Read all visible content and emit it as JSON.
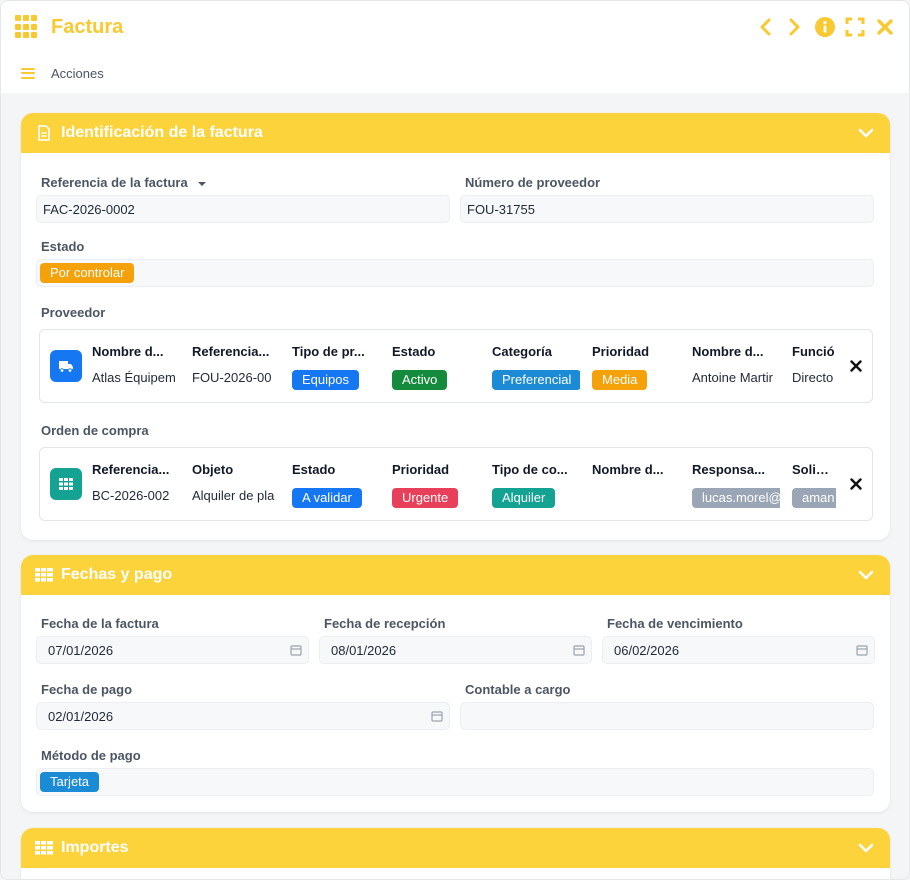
{
  "window": {
    "title": "Factura"
  },
  "menubar": {
    "actions_label": "Acciones"
  },
  "colors": {
    "accent": "#f9c932",
    "header": "#fdd33c"
  },
  "section1": {
    "title": "Identificación de la factura",
    "ref_label": "Referencia de la factura",
    "ref_value": "FAC-2026-0002",
    "supplier_number_label": "Número de proveedor",
    "supplier_number_value": "FOU-31755",
    "status_label": "Estado",
    "status_value": "Por controlar",
    "provider_label": "Proveedor",
    "provider_card": {
      "columns": [
        {
          "header": "Nombre d...",
          "value": "Atlas Équipem",
          "type": "text"
        },
        {
          "header": "Referencia...",
          "value": "FOU-2026-00",
          "type": "text"
        },
        {
          "header": "Tipo de pr...",
          "value": "Equipos",
          "type": "pill",
          "color": "#1677f2"
        },
        {
          "header": "Estado",
          "value": "Activo",
          "type": "pill",
          "color": "#148a3c"
        },
        {
          "header": "Categoría",
          "value": "Preferencial",
          "type": "pill",
          "color": "#1b8bd6"
        },
        {
          "header": "Prioridad",
          "value": "Media",
          "type": "pill",
          "color": "#f4a10a"
        },
        {
          "header": "Nombre d...",
          "value": "Antoine Martir",
          "type": "text"
        },
        {
          "header": "Funció",
          "value": "Directo",
          "type": "text"
        }
      ]
    },
    "order_label": "Orden de compra",
    "order_card": {
      "columns": [
        {
          "header": "Referencia...",
          "value": "BC-2026-002",
          "type": "text"
        },
        {
          "header": "Objeto",
          "value": "Alquiler de pla",
          "type": "text"
        },
        {
          "header": "Estado",
          "value": "A validar",
          "type": "pill",
          "color": "#1677f2"
        },
        {
          "header": "Prioridad",
          "value": "Urgente",
          "type": "pill",
          "color": "#e8405a"
        },
        {
          "header": "Tipo de co...",
          "value": "Alquiler",
          "type": "pill",
          "color": "#14a393"
        },
        {
          "header": "Nombre d...",
          "value": "",
          "type": "text"
        },
        {
          "header": "Responsa...",
          "value": "lucas.morel@",
          "type": "pill",
          "color": "#9aa6b6"
        },
        {
          "header": "Solicita",
          "value": "aman",
          "type": "pill",
          "color": "#9aa6b6"
        }
      ]
    }
  },
  "section2": {
    "title": "Fechas y pago",
    "invoice_date_label": "Fecha de la factura",
    "invoice_date_value": "07/01/2026",
    "reception_date_label": "Fecha de recepción",
    "reception_date_value": "08/01/2026",
    "due_date_label": "Fecha de vencimiento",
    "due_date_value": "06/02/2026",
    "payment_date_label": "Fecha de pago",
    "payment_date_value": "02/01/2026",
    "accountant_label": "Contable a cargo",
    "accountant_value": "",
    "method_label": "Método de pago",
    "method_value": "Tarjeta"
  },
  "section3": {
    "title": "Importes"
  }
}
